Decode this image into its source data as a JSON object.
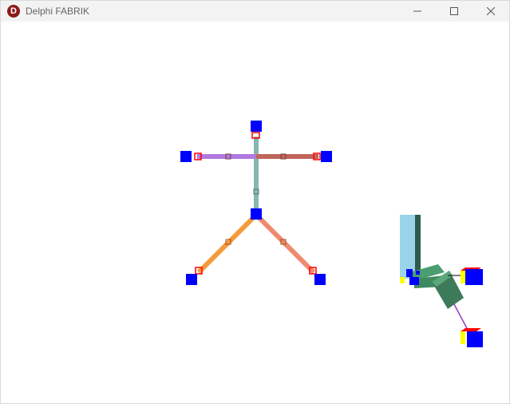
{
  "window": {
    "title": "Delphi FABRIK",
    "icon_letter": "D",
    "icon_name": "delphi-app-icon",
    "controls": [
      "minimize-icon",
      "maximize-icon",
      "close-icon"
    ]
  },
  "colors": {
    "joint_box": "#0000ff",
    "spine": "#86b7b1",
    "left_arm": "#b07ae0",
    "right_arm": "#c0655c",
    "left_leg": "#f59a3a",
    "right_leg": "#ee8a6e",
    "target_marker": "#ff0000",
    "cube_top": "#ff0000",
    "cube_side": "#ffff00",
    "pillar": "#9bd3e8",
    "pillar_shadow": "#2e5a4f",
    "arm_segment": "#4a9e70",
    "chain_line": "#9b39c4"
  }
}
